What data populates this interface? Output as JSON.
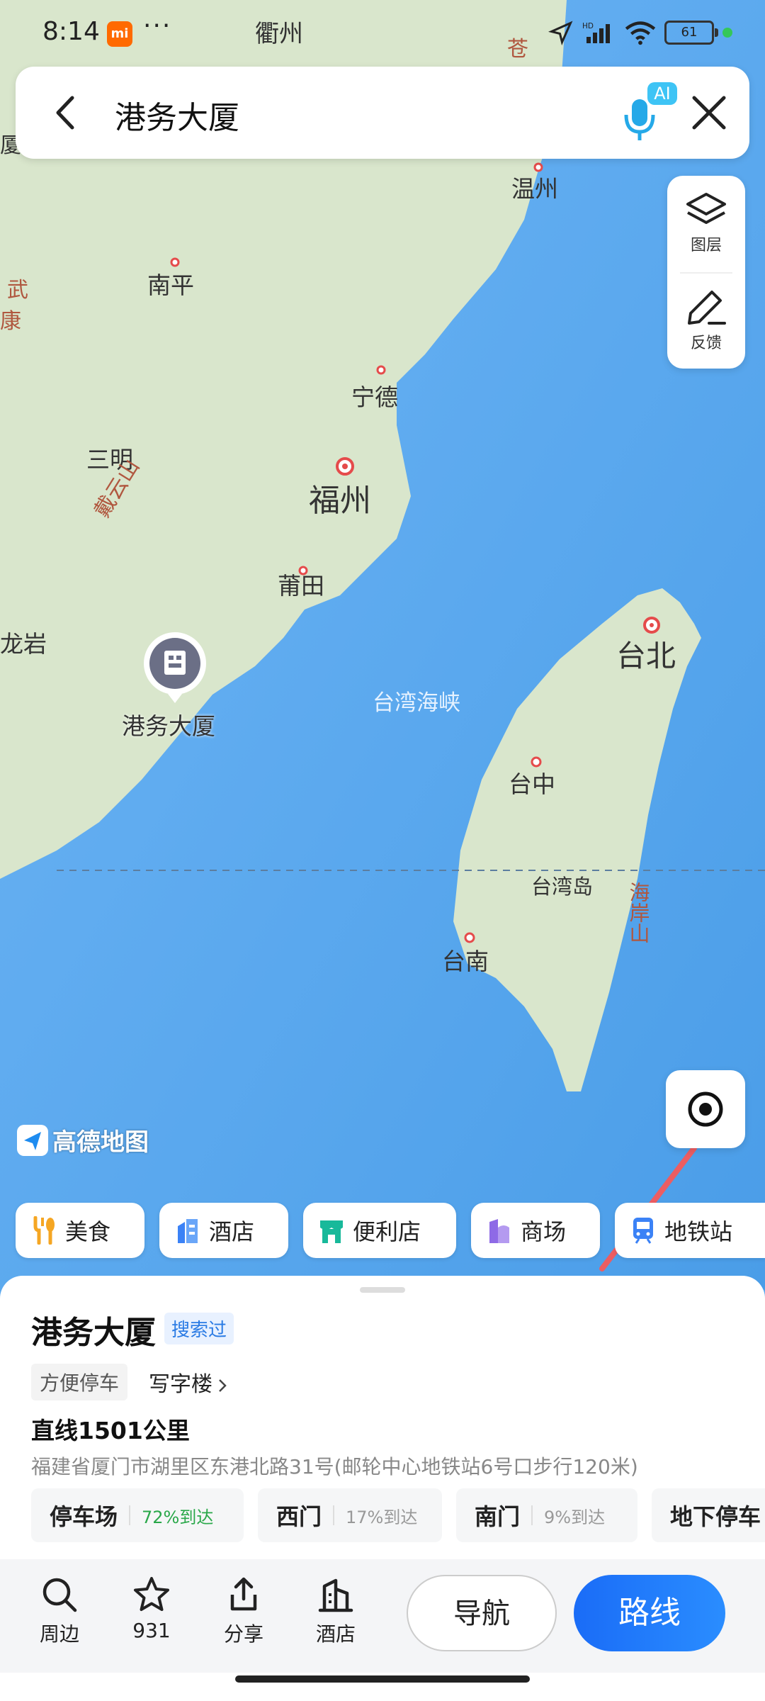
{
  "status_bar": {
    "time": "8:14",
    "mi_badge": "mi",
    "more": "···",
    "battery": "61",
    "signal_label": "HD"
  },
  "search": {
    "query": "港务大厦",
    "ai_badge": "AI"
  },
  "map": {
    "cities": {
      "quzhou": "衢州",
      "wenzhou": "温州",
      "nanping": "南平",
      "ningde": "宁德",
      "sanming": "三明",
      "fuzhou": "福州",
      "putian": "莆田",
      "longyan": "龙岩",
      "taibei": "台北",
      "taizhong": "台中",
      "tainan": "台南",
      "taiwan_island": "台湾岛",
      "strait": "台湾海峡",
      "wuyishan": "戴云山",
      "haian_mtn": "海岸山",
      "wu": "武",
      "kang": "康",
      "xia": "厦",
      "cang": "苍"
    },
    "poi_label": "港务大厦",
    "watermark": "高德地图"
  },
  "tools": {
    "layers": "图层",
    "feedback": "反馈"
  },
  "chips": [
    {
      "label": "美食",
      "color": "#f5a623"
    },
    {
      "label": "酒店",
      "color": "#3b82f6"
    },
    {
      "label": "便利店",
      "color": "#18b99a"
    },
    {
      "label": "商场",
      "color": "#8e6ae6"
    },
    {
      "label": "地铁站",
      "color": "#3b82f6"
    }
  ],
  "place": {
    "name": "港务大厦",
    "searched": "搜索过",
    "tag_parking": "方便停车",
    "tag_office": "写字楼",
    "distance": "直线1501公里",
    "address": "福建省厦门市湖里区东港北路31号(邮轮中心地铁站6号口步行120米)",
    "entrances": [
      {
        "name": "停车场",
        "pct": "72%到达",
        "pct_color": "#2aa84a"
      },
      {
        "name": "西门",
        "pct": "17%到达",
        "pct_color": "#999999"
      },
      {
        "name": "南门",
        "pct": "9%到达",
        "pct_color": "#999999"
      },
      {
        "name": "地下停车",
        "pct": "",
        "pct_color": "#999999"
      }
    ]
  },
  "actions": {
    "nearby": "周边",
    "favorite": "931",
    "share": "分享",
    "hotel": "酒店",
    "navigate": "导航",
    "route": "路线"
  }
}
